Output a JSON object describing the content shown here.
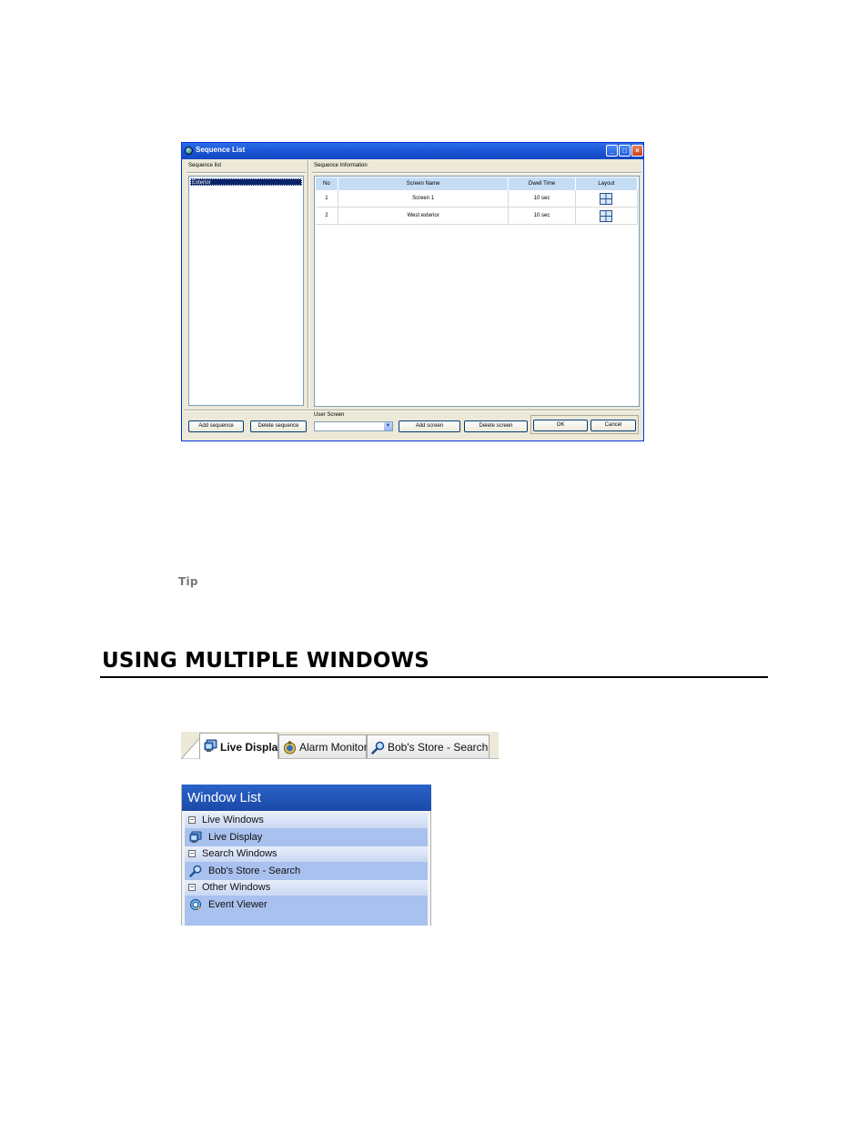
{
  "dialog": {
    "title": "Sequence List",
    "sequence_list_label": "Sequence list",
    "sequence_info_label": "Sequence Information",
    "sequences": [
      "Exterior"
    ],
    "columns": [
      "No",
      "Screen Name",
      "Dwell Time",
      "Layout"
    ],
    "rows": [
      {
        "no": "1",
        "name": "Screen 1",
        "dwell": "10 sec",
        "layout": "quad-layout-icon"
      },
      {
        "no": "2",
        "name": "West exterior",
        "dwell": "10 sec",
        "layout": "quad-layout-icon"
      }
    ],
    "user_screen_label": "User Screen",
    "user_screen_value": "",
    "buttons": {
      "add_sequence": "Add sequence",
      "delete_sequence": "Delete sequence",
      "add_screen": "Add screen",
      "delete_screen": "Delete screen",
      "ok": "OK",
      "cancel": "Cancel"
    }
  },
  "doc": {
    "tip": "Tip",
    "heading": "USING MULTIPLE WINDOWS"
  },
  "tabs": [
    {
      "label": "Live Display",
      "icon": "monitor-icon",
      "active": true
    },
    {
      "label": "Alarm Monitor",
      "icon": "alarm-icon",
      "active": false
    },
    {
      "label": "Bob's Store - Search",
      "icon": "search-icon",
      "active": false
    }
  ],
  "window_list": {
    "title": "Window List",
    "groups": [
      {
        "label": "Live Windows",
        "items": [
          {
            "label": "Live Display",
            "icon": "monitor-icon"
          }
        ]
      },
      {
        "label": "Search Windows",
        "items": [
          {
            "label": "Bob's Store - Search",
            "icon": "search-icon"
          }
        ]
      },
      {
        "label": "Other Windows",
        "items": [
          {
            "label": "Event Viewer",
            "icon": "event-viewer-icon"
          }
        ]
      }
    ]
  },
  "colors": {
    "titlebar": "#1a55d6",
    "grid_header": "#c5dcf5",
    "window_list_header": "#1a4aa8",
    "window_list_body": "#a9c1ee"
  }
}
